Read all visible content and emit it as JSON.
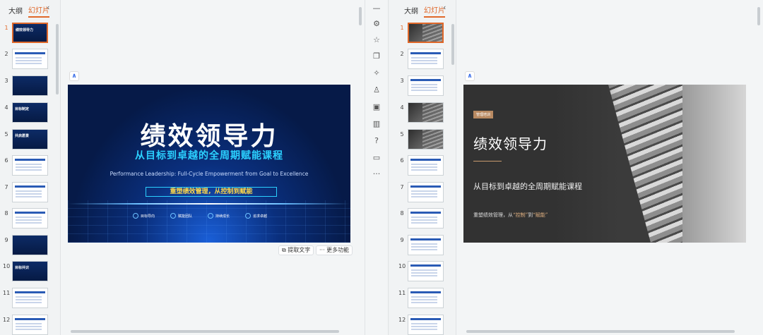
{
  "left_panel": {
    "tabs": [
      "大纲",
      "幻灯片"
    ],
    "active_tab": "幻灯片",
    "collapse_icon": "chevron-left-icon",
    "slide_numbers": [
      "1",
      "2",
      "3",
      "4",
      "5",
      "6",
      "7",
      "8",
      "9",
      "10",
      "11",
      "12"
    ],
    "selected_slide": "1",
    "thumb_titles": {
      "t1": "绩效领导力",
      "t4": "目标制定",
      "t5": "共启愿景",
      "t10": "目标共识"
    }
  },
  "left_slide": {
    "title": "绩效领导力",
    "subtitle": "从目标到卓越的全周期赋能课程",
    "english": "Performance Leadership: Full-Cycle Empowerment from Goal to Excellence",
    "slogan": "重塑绩效管理，从控制到赋能",
    "features": [
      "目标导向",
      "赋能团队",
      "持续成长",
      "追求卓越"
    ]
  },
  "left_actions": {
    "extract_text": "提取文字",
    "more_features": "更多功能"
  },
  "toolbar_icons": [
    "minus-icon",
    "settings-sliders-icon",
    "star-icon",
    "copy-icon",
    "magic-icon",
    "shirt-icon",
    "image-edit-icon",
    "book-icon",
    "help-icon",
    "comment-icon",
    "more-icon"
  ],
  "right_panel": {
    "tabs": [
      "大纲",
      "幻灯片"
    ],
    "active_tab": "幻灯片",
    "slide_numbers": [
      "1",
      "2",
      "3",
      "4",
      "5",
      "6",
      "7",
      "8",
      "9",
      "10",
      "11",
      "12"
    ],
    "selected_slide": "1"
  },
  "right_slide": {
    "tag": "管理培训",
    "title": "绩效领导力",
    "subtitle": "从目标到卓越的全周期赋能课程",
    "desc_prefix": "重塑绩效管理，从",
    "desc_h1": "“控制”",
    "desc_mid": "到",
    "desc_h2": "“赋能”"
  },
  "colors": {
    "accent": "#e0682a",
    "slide_blue": "#0a2f7d",
    "highlight": "#2bd0ff"
  }
}
